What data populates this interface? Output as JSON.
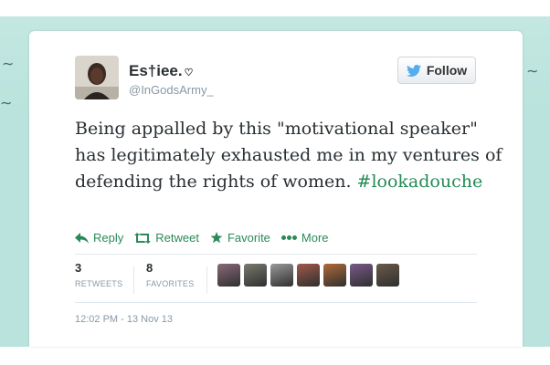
{
  "user": {
    "display_name": "Es†iee.",
    "heart": "♡",
    "handle": "@InGodsArmy_",
    "avatar_icon": "avatar-photo"
  },
  "follow": {
    "label": "Follow",
    "icon": "twitter-bird-icon"
  },
  "tweet": {
    "text": "Being appalled by this \"motivational speaker\" has legitimately exhausted me in my ventures of defending the rights of women.",
    "hashtag": "#lookadouche"
  },
  "actions": [
    {
      "label": "Reply",
      "icon": "reply-arrow-icon"
    },
    {
      "label": "Retweet",
      "icon": "retweet-icon"
    },
    {
      "label": "Favorite",
      "icon": "star-icon"
    },
    {
      "label": "More",
      "icon": "more-dots-icon"
    }
  ],
  "stats": {
    "retweets": {
      "count": "3",
      "label": "RETWEETS"
    },
    "favorites": {
      "count": "8",
      "label": "FAVORITES"
    }
  },
  "favoriter_avatars": [
    "#8a6a7a",
    "#7a7a70",
    "#9a9a9a",
    "#a05a4a",
    "#b06a3a",
    "#7a5a8a",
    "#6a5a4a"
  ],
  "timestamp": "12:02 PM - 13 Nov 13",
  "colors": {
    "background": "#b9e3dc",
    "link_green": "#2a8a57",
    "follow_blue": "#55acee"
  }
}
